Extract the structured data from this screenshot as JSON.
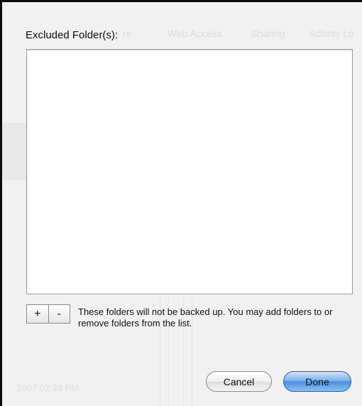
{
  "ghost": {
    "tabs": [
      "re",
      "Web Access",
      "Sharing",
      "Activity Lo"
    ],
    "timestamp": "2007 02:38 PM"
  },
  "dialog": {
    "title": "Excluded Folder(s):",
    "add_label": "+",
    "remove_label": "-",
    "note": "These folders will not be backed up. You may add folders to or remove folders from the list.",
    "cancel_label": "Cancel",
    "done_label": "Done",
    "folders": []
  },
  "colors": {
    "sheet_bg": "#f1f1f1",
    "default_button": "#4b8fe0"
  }
}
